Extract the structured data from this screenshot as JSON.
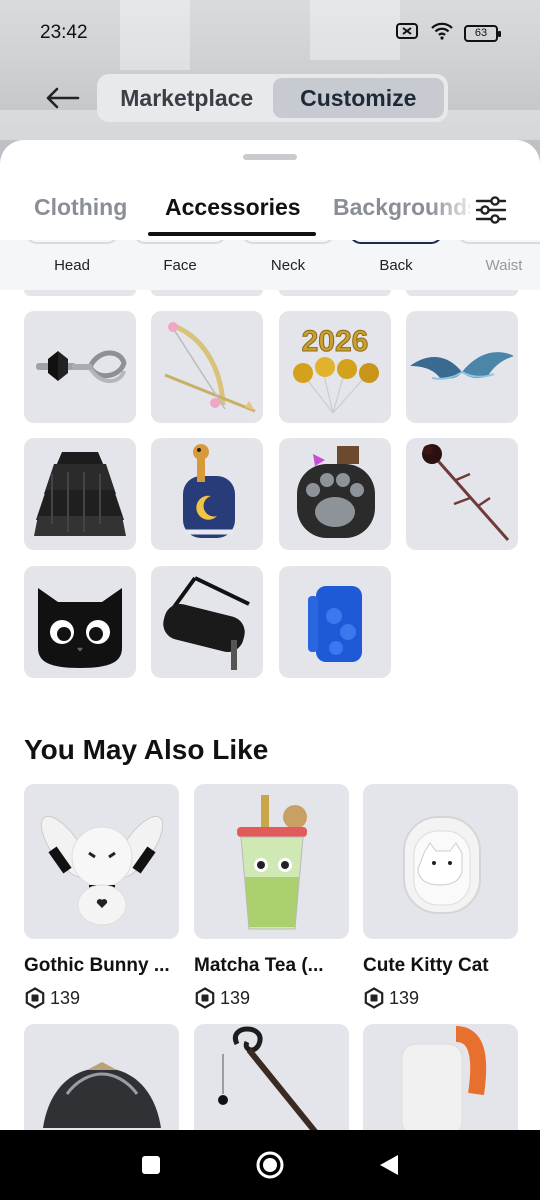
{
  "status": {
    "time": "23:42",
    "battery": "63"
  },
  "header": {
    "segments": [
      {
        "label": "Marketplace",
        "active": false
      },
      {
        "label": "Customize",
        "active": true
      }
    ]
  },
  "tabs": [
    {
      "label": "Clothing",
      "active": false
    },
    {
      "label": "Accessories",
      "active": true
    },
    {
      "label": "Backgrounds",
      "active": false
    }
  ],
  "subcategories": [
    {
      "label": "Head",
      "selected": false
    },
    {
      "label": "Face",
      "selected": false
    },
    {
      "label": "Neck",
      "selected": false
    },
    {
      "label": "Back",
      "selected": true
    },
    {
      "label": "Waist",
      "selected": false
    }
  ],
  "items": [
    {
      "name": "bow-key-wing"
    },
    {
      "name": "golden-bow-arrow"
    },
    {
      "name": "2026-balloons",
      "text": "2026"
    },
    {
      "name": "blue-wings"
    },
    {
      "name": "black-ruffle-cape"
    },
    {
      "name": "giraffe-moon-backpack"
    },
    {
      "name": "paw-backpack"
    },
    {
      "name": "black-rose"
    },
    {
      "name": "black-cat-backpack"
    },
    {
      "name": "black-duffel-bag"
    },
    {
      "name": "blue-brick-backpack"
    }
  ],
  "recommendations": {
    "title": "You May Also Like",
    "items": [
      {
        "name": "Gothic Bunny ...",
        "price": "139"
      },
      {
        "name": "Matcha Tea (...",
        "price": "139"
      },
      {
        "name": "Cute Kitty Cat",
        "price": "139"
      }
    ]
  },
  "colors": {
    "accent": "#1b2a52",
    "tile": "#e4e5ea",
    "navbar": "#000000"
  }
}
